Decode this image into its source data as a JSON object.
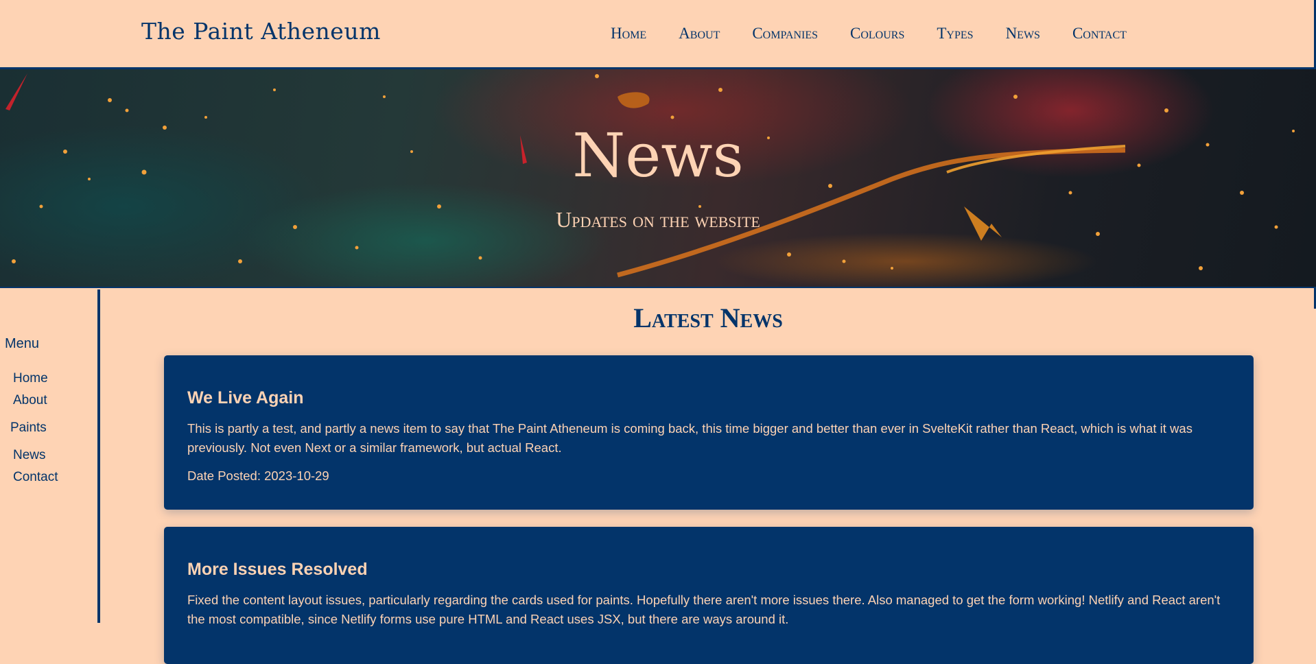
{
  "header": {
    "site_title": "The Paint Atheneum",
    "nav": [
      "Home",
      "About",
      "Companies",
      "Colours",
      "Types",
      "News",
      "Contact"
    ]
  },
  "hero": {
    "title": "News",
    "subtitle": "Updates on the website"
  },
  "sidebar": {
    "title": "Menu",
    "items": [
      "Home",
      "About",
      "Paints",
      "News",
      "Contact"
    ]
  },
  "main": {
    "section_title": "Latest News",
    "articles": [
      {
        "title": "We Live Again",
        "body": "This is partly a test, and partly a news item to say that The Paint Atheneum is coming back, this time bigger and better than ever in SvelteKit rather than React, which is what it was previously. Not even Next or a similar framework, but actual React.",
        "date": "Date Posted: 2023-10-29"
      },
      {
        "title": "More Issues Resolved",
        "body": "Fixed the content layout issues, particularly regarding the cards used for paints. Hopefully there aren't more issues there. Also managed to get the form working! Netlify and React aren't the most compatible, since Netlify forms use pure HTML and React uses JSX, but there are ways around it."
      }
    ]
  },
  "colors": {
    "background": "#fed3b4",
    "primary": "#03346a"
  }
}
